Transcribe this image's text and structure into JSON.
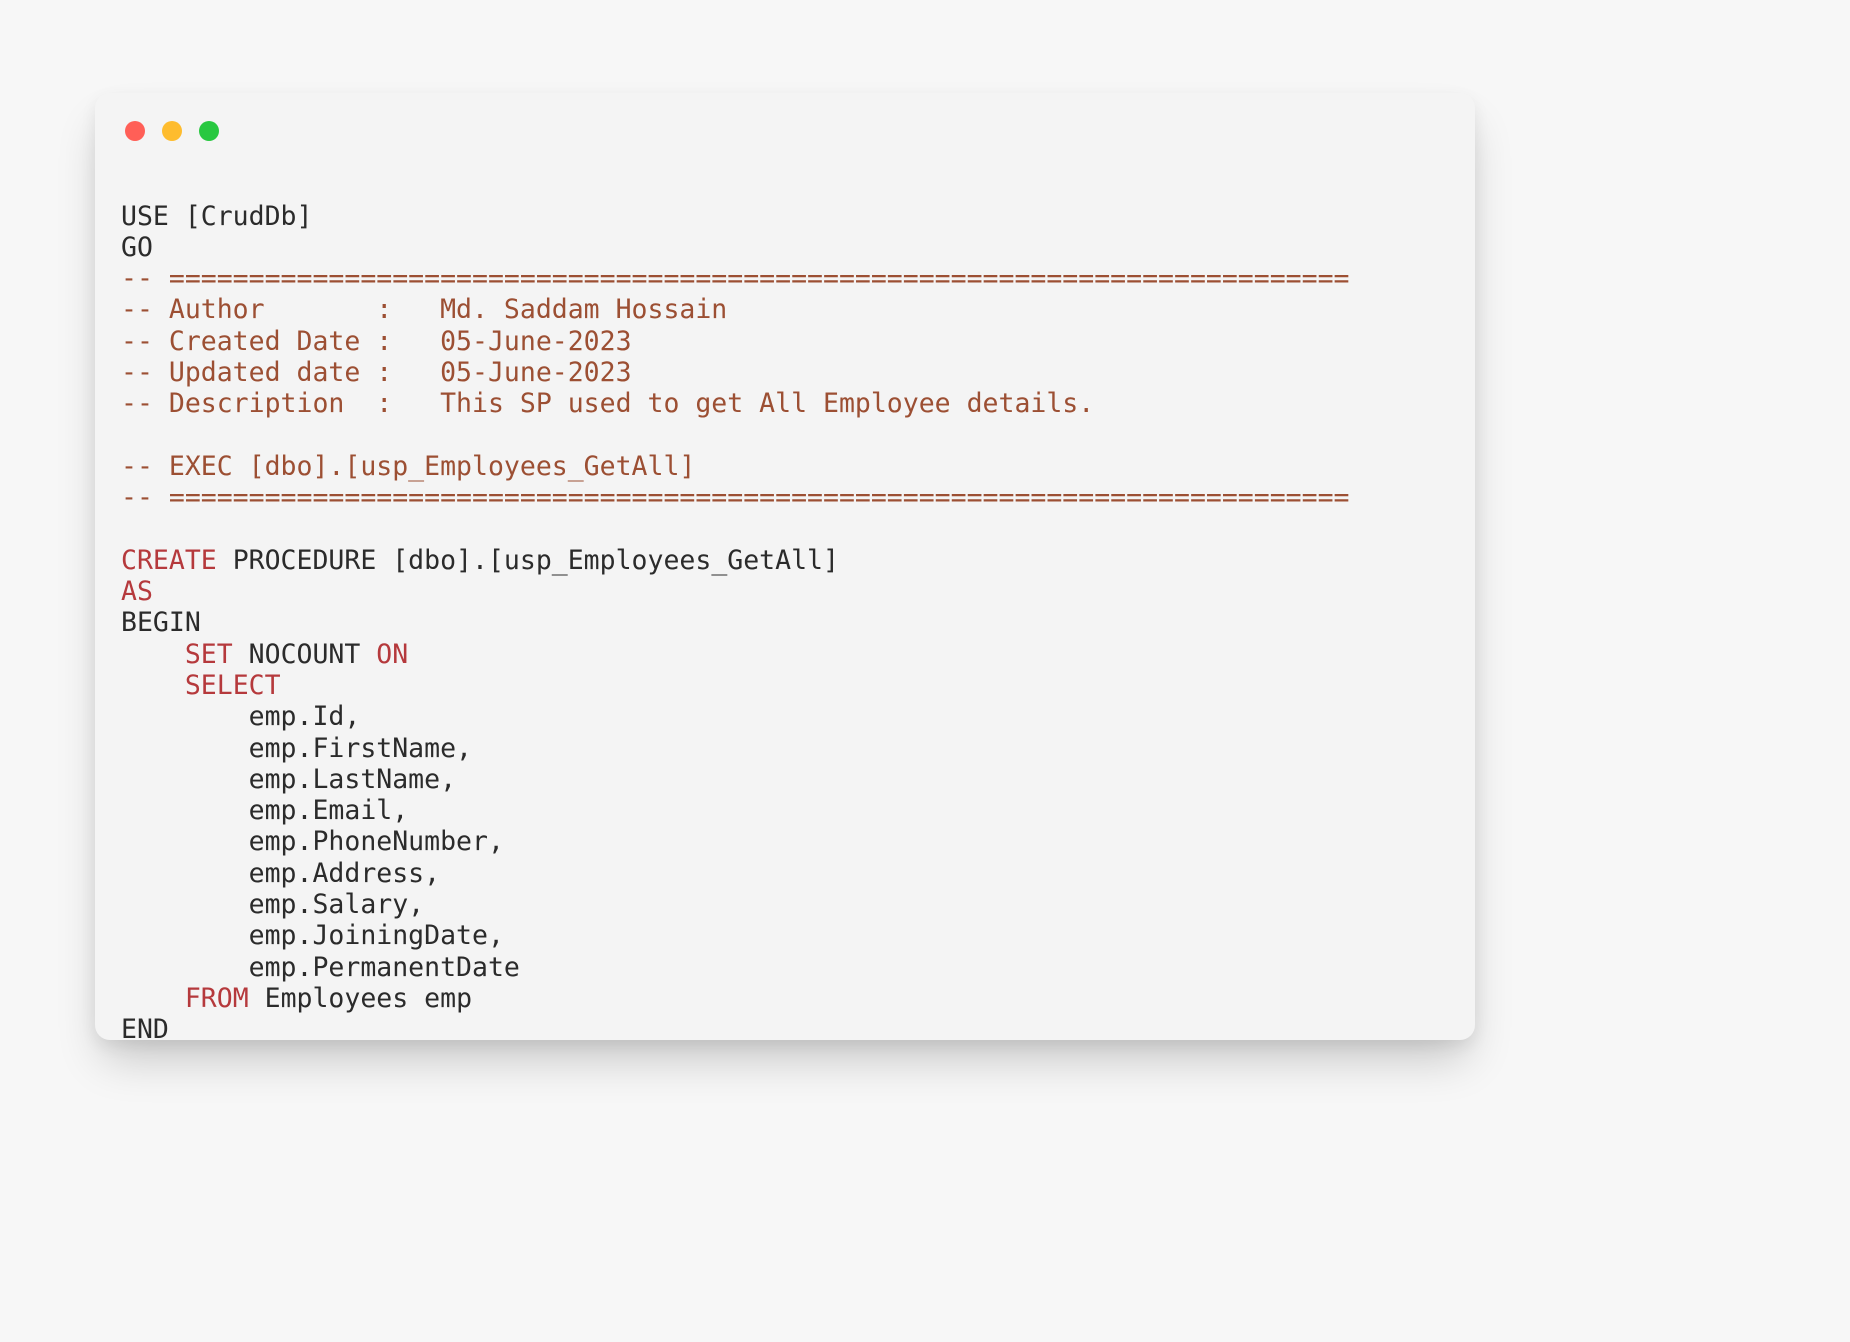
{
  "window": {
    "buttons": [
      {
        "name": "close",
        "label": "Close",
        "color": "#ff5f57"
      },
      {
        "name": "minimize",
        "label": "Minimize",
        "color": "#febc2e"
      },
      {
        "name": "zoom",
        "label": "Zoom",
        "color": "#28c840"
      }
    ]
  },
  "theme": {
    "page_background": "#f7f7f7",
    "card_background": "#f4f4f4",
    "plain_text": "#2b2b2b",
    "comment_color": "#9c4f33",
    "keyword_color": "#b5393c"
  },
  "code": {
    "language": "sql",
    "lines": [
      {
        "id": "l01",
        "segments": [
          {
            "t": "plain",
            "text": "USE [CrudDb]"
          }
        ]
      },
      {
        "id": "l02",
        "segments": [
          {
            "t": "plain",
            "text": "GO"
          }
        ]
      },
      {
        "id": "l03",
        "segments": [
          {
            "t": "comment",
            "text": "-- =========================================================================="
          }
        ]
      },
      {
        "id": "l04",
        "segments": [
          {
            "t": "comment",
            "text": "-- Author       :   Md. Saddam Hossain"
          }
        ]
      },
      {
        "id": "l05",
        "segments": [
          {
            "t": "comment",
            "text": "-- Created Date :   05-June-2023"
          }
        ]
      },
      {
        "id": "l06",
        "segments": [
          {
            "t": "comment",
            "text": "-- Updated date :   05-June-2023"
          }
        ]
      },
      {
        "id": "l07",
        "segments": [
          {
            "t": "comment",
            "text": "-- Description  :   This SP used to get All Employee details."
          }
        ]
      },
      {
        "id": "l08",
        "segments": [
          {
            "t": "plain",
            "text": ""
          }
        ]
      },
      {
        "id": "l09",
        "segments": [
          {
            "t": "comment",
            "text": "-- EXEC [dbo].[usp_Employees_GetAll]"
          }
        ]
      },
      {
        "id": "l10",
        "segments": [
          {
            "t": "comment",
            "text": "-- =========================================================================="
          }
        ]
      },
      {
        "id": "l11",
        "segments": [
          {
            "t": "plain",
            "text": ""
          }
        ]
      },
      {
        "id": "l12",
        "segments": [
          {
            "t": "keyword",
            "text": "CREATE"
          },
          {
            "t": "plain",
            "text": " PROCEDURE [dbo].[usp_Employees_GetAll]"
          }
        ]
      },
      {
        "id": "l13",
        "segments": [
          {
            "t": "keyword",
            "text": "AS"
          }
        ]
      },
      {
        "id": "l14",
        "segments": [
          {
            "t": "plain",
            "text": "BEGIN"
          }
        ]
      },
      {
        "id": "l15",
        "segments": [
          {
            "t": "plain",
            "text": "    "
          },
          {
            "t": "keyword",
            "text": "SET"
          },
          {
            "t": "plain",
            "text": " NOCOUNT "
          },
          {
            "t": "keyword",
            "text": "ON"
          }
        ]
      },
      {
        "id": "l16",
        "segments": [
          {
            "t": "plain",
            "text": "    "
          },
          {
            "t": "keyword",
            "text": "SELECT"
          }
        ]
      },
      {
        "id": "l17",
        "segments": [
          {
            "t": "plain",
            "text": "        emp.Id,"
          }
        ]
      },
      {
        "id": "l18",
        "segments": [
          {
            "t": "plain",
            "text": "        emp.FirstName,"
          }
        ]
      },
      {
        "id": "l19",
        "segments": [
          {
            "t": "plain",
            "text": "        emp.LastName,"
          }
        ]
      },
      {
        "id": "l20",
        "segments": [
          {
            "t": "plain",
            "text": "        emp.Email,"
          }
        ]
      },
      {
        "id": "l21",
        "segments": [
          {
            "t": "plain",
            "text": "        emp.PhoneNumber,"
          }
        ]
      },
      {
        "id": "l22",
        "segments": [
          {
            "t": "plain",
            "text": "        emp.Address,"
          }
        ]
      },
      {
        "id": "l23",
        "segments": [
          {
            "t": "plain",
            "text": "        emp.Salary,"
          }
        ]
      },
      {
        "id": "l24",
        "segments": [
          {
            "t": "plain",
            "text": "        emp.JoiningDate,"
          }
        ]
      },
      {
        "id": "l25",
        "segments": [
          {
            "t": "plain",
            "text": "        emp.PermanentDate"
          }
        ]
      },
      {
        "id": "l26",
        "segments": [
          {
            "t": "plain",
            "text": "    "
          },
          {
            "t": "keyword",
            "text": "FROM"
          },
          {
            "t": "plain",
            "text": " Employees emp"
          }
        ]
      },
      {
        "id": "l27",
        "segments": [
          {
            "t": "plain",
            "text": "END"
          }
        ]
      }
    ]
  }
}
